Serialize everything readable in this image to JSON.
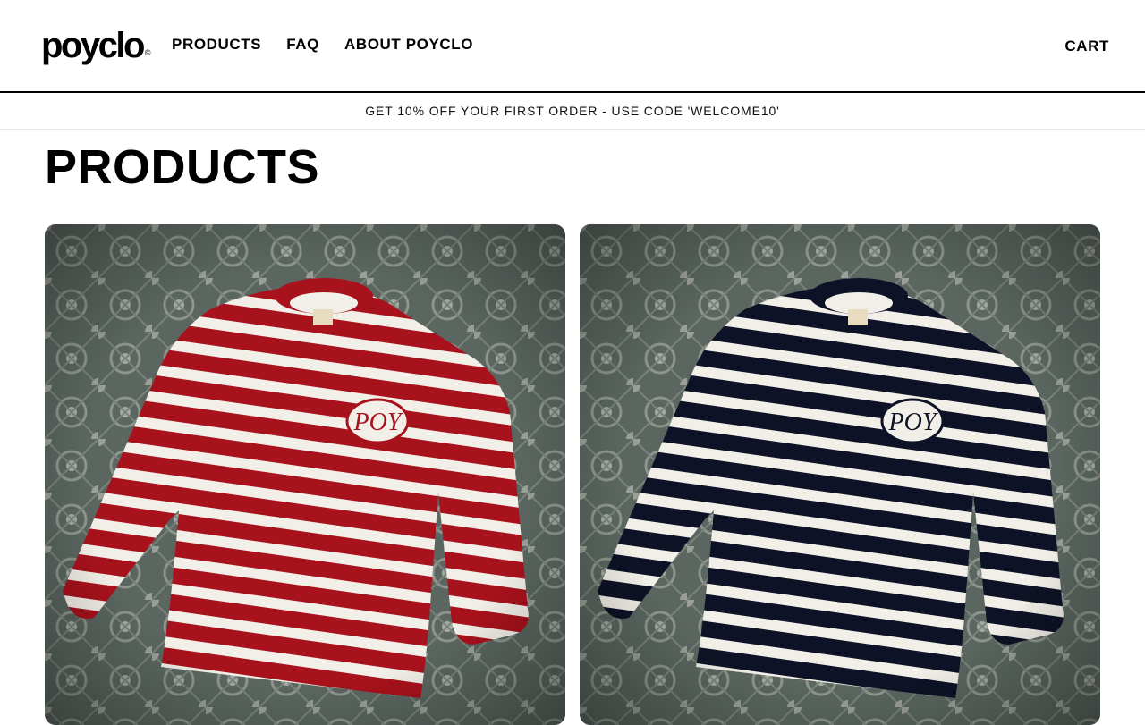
{
  "header": {
    "logo_text": "poyclo",
    "logo_mark": "©",
    "nav": [
      {
        "label": "PRODUCTS"
      },
      {
        "label": "FAQ"
      },
      {
        "label": "ABOUT POYCLO"
      }
    ],
    "cart_label": "CART"
  },
  "announcement": {
    "text": "GET 10% OFF YOUR FIRST ORDER - USE CODE 'WELCOME10'"
  },
  "main": {
    "title": "PRODUCTS",
    "products": [
      {
        "image": "red-white-striped-sweater",
        "stripe_color": "#a8121c",
        "badge": "POY"
      },
      {
        "image": "navy-white-striped-sweater",
        "stripe_color": "#0d1226",
        "badge": "POY"
      }
    ]
  },
  "colors": {
    "text": "#000000",
    "background": "#ffffff",
    "rug": "#5b6660",
    "stripe_light": "#f2efe8"
  }
}
